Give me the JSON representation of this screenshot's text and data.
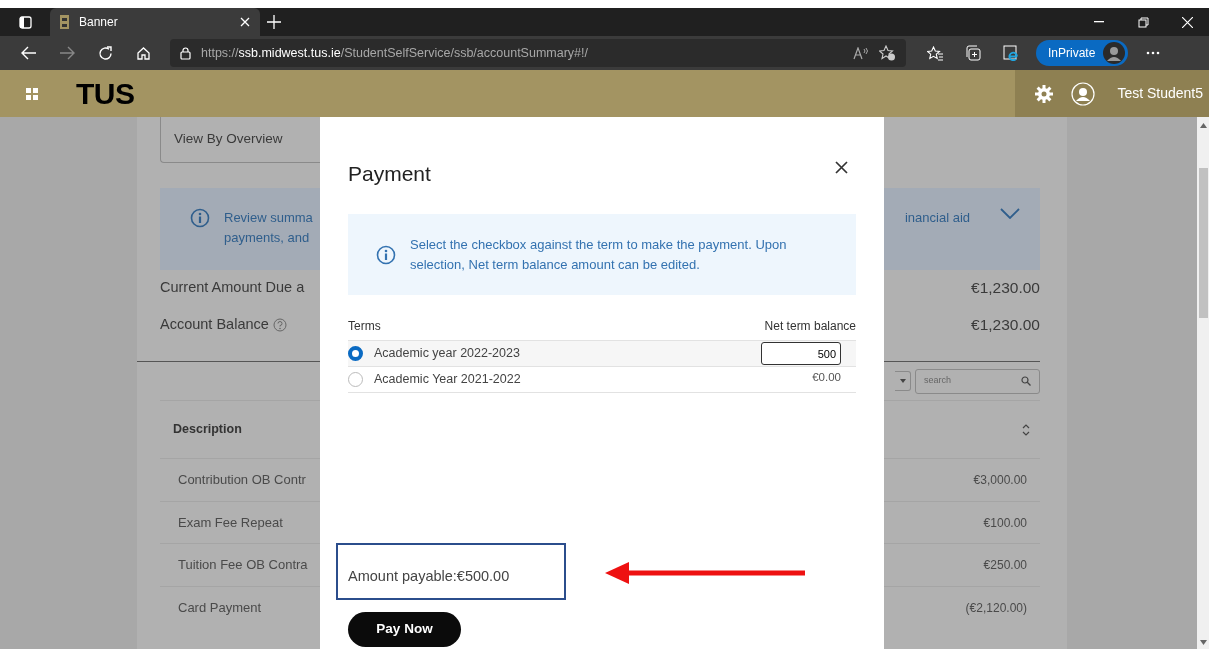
{
  "browser": {
    "tab": {
      "title": "Banner",
      "selected": true
    },
    "url": {
      "scheme": "https://",
      "host": "ssb.midwest.tus.ie",
      "path": "/StudentSelfService/ssb/accountSummary#!/"
    },
    "profile_label": "InPrivate"
  },
  "app_header": {
    "logo": "TUS",
    "user_name": "Test Student5"
  },
  "background": {
    "view_select": "View By Overview",
    "banner": {
      "text_left": [
        "Review summa",
        "payments, and"
      ],
      "text_right": "inancial aid"
    },
    "summary": [
      {
        "label": "Current Amount Due a",
        "value": "€1,230.00",
        "help": false
      },
      {
        "label": "Account Balance",
        "value": "€1,230.00",
        "help": true
      }
    ],
    "search": {
      "placeholder": "search"
    },
    "table": {
      "column": "Description",
      "rows": [
        {
          "description": "Contribution OB Contr",
          "amount": "€3,000.00"
        },
        {
          "description": "Exam Fee Repeat",
          "amount": "€100.00"
        },
        {
          "description": "Tuition Fee OB Contra",
          "amount": "€250.00"
        },
        {
          "description": "Card Payment",
          "amount": "(€2,120.00)"
        }
      ]
    }
  },
  "modal": {
    "title": "Payment",
    "info": "Select the checkbox against the term to make the payment. Upon selection, Net term balance amount can be edited.",
    "columns": [
      "Terms",
      "Net term balance"
    ],
    "terms": [
      {
        "name": "Academic year 2022-2023",
        "selected": true,
        "balance": "500"
      },
      {
        "name": "Academic Year 2021-2022",
        "selected": false,
        "balance": "€0.00"
      }
    ],
    "amount_payable": "Amount payable:€500.00",
    "pay_button": "Pay Now"
  }
}
